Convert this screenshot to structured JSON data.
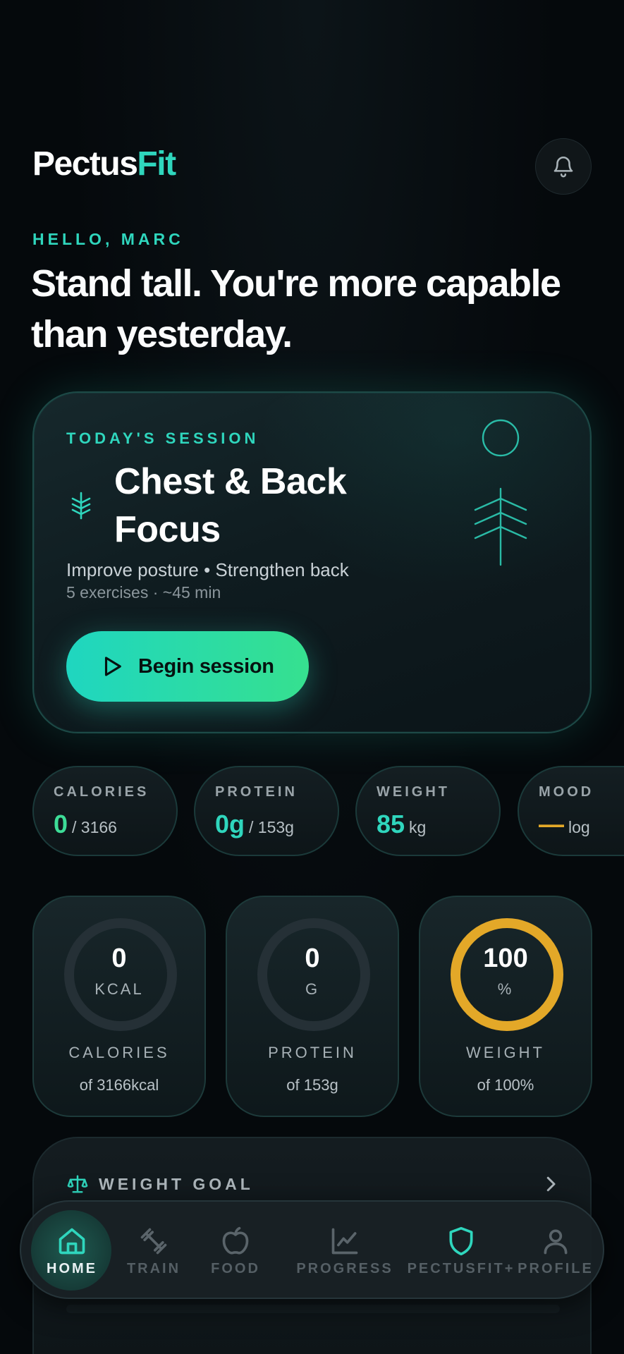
{
  "app": {
    "brand_part1": "Pectus",
    "brand_part2": "Fit"
  },
  "greeting": "HELLO, MARC",
  "headline": "Stand tall. You're more capable than yesterday.",
  "session": {
    "label": "TODAY'S SESSION",
    "title": "Chest & Back Focus",
    "subtitle": "Improve posture • Strengthen back",
    "meta": "5 exercises · ~45 min",
    "button": "Begin session"
  },
  "stats": [
    {
      "label": "CALORIES",
      "value": "0",
      "unit": "/ 3166"
    },
    {
      "label": "PROTEIN",
      "value": "0g",
      "unit": "/ 153g"
    },
    {
      "label": "WEIGHT",
      "value": "85",
      "unit": "kg"
    },
    {
      "label": "MOOD",
      "value": "—",
      "unit": "log"
    }
  ],
  "rings": [
    {
      "value": "0",
      "unit": "KCAL",
      "label": "CALORIES",
      "of": "of 3166kcal",
      "progress": 0
    },
    {
      "value": "0",
      "unit": "G",
      "label": "PROTEIN",
      "of": "of 153g",
      "progress": 0
    },
    {
      "value": "100",
      "unit": "%",
      "label": "WEIGHT",
      "of": "of 100%",
      "progress": 1
    }
  ],
  "goal": {
    "label": "WEIGHT GOAL"
  },
  "nav": [
    {
      "label": "HOME",
      "icon": "home-icon",
      "active": true
    },
    {
      "label": "TRAIN",
      "icon": "dumbbell-icon"
    },
    {
      "label": "FOOD",
      "icon": "apple-icon"
    },
    {
      "label": "PROGRESS",
      "icon": "chart-icon"
    },
    {
      "label": "PECTUSFIT+",
      "icon": "shield-icon"
    },
    {
      "label": "PROFILE",
      "icon": "user-icon"
    }
  ],
  "colors": {
    "accent": "#2fd6bd",
    "green": "#3ddc97",
    "gold": "#e3a828",
    "background": "#05090c"
  }
}
